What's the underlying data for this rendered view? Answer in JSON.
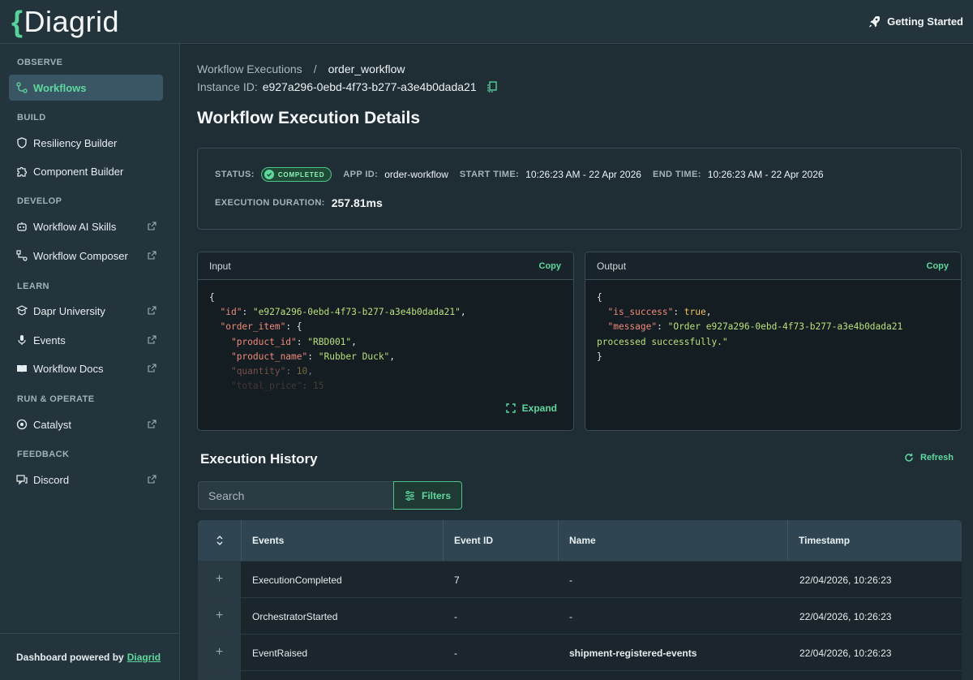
{
  "app": {
    "logo_brace": "{",
    "logo_text": "Diagrid"
  },
  "header": {
    "getting_started": "Getting Started"
  },
  "sidebar": {
    "sections": {
      "observe": "OBSERVE",
      "build": "BUILD",
      "develop": "DEVELOP",
      "learn": "LEARN",
      "run_operate": "RUN & OPERATE",
      "feedback": "FEEDBACK"
    },
    "items": {
      "workflows": "Workflows",
      "resiliency_builder": "Resiliency Builder",
      "component_builder": "Component Builder",
      "workflow_ai_skills": "Workflow AI Skills",
      "workflow_composer": "Workflow Composer",
      "dapr_university": "Dapr University",
      "events": "Events",
      "workflow_docs": "Workflow Docs",
      "catalyst": "Catalyst",
      "discord": "Discord"
    },
    "powered_by": "Dashboard powered by",
    "powered_link": "Diagrid"
  },
  "breadcrumb": {
    "parent": "Workflow Executions",
    "separator": "/",
    "current": "order_workflow"
  },
  "instance": {
    "label": "Instance ID:",
    "value": "e927a296-0ebd-4f73-b277-a3e4b0dada21"
  },
  "page_title": "Workflow Execution Details",
  "details": {
    "status_label": "STATUS:",
    "status_value": "COMPLETED",
    "app_id_label": "APP ID:",
    "app_id_value": "order-workflow",
    "start_label": "START TIME:",
    "start_value": "10:26:23 AM - 22 Apr 2026",
    "end_label": "END TIME:",
    "end_value": "10:26:23 AM - 22 Apr 2026",
    "duration_label": "EXECUTION DURATION:",
    "duration_value": "257.81ms"
  },
  "input_panel": {
    "title": "Input",
    "copy": "Copy",
    "expand": "Expand",
    "lines": {
      "open": "{",
      "id_key": "\"id\"",
      "id_val": "\"e927a296-0ebd-4f73-b277-a3e4b0dada21\"",
      "order_key": "\"order_item\"",
      "order_open": ": {",
      "pid_key": "\"product_id\"",
      "pid_val": "\"RBD001\"",
      "pname_key": "\"product_name\"",
      "pname_val": "\"Rubber Duck\"",
      "qty_key": "\"quantity\"",
      "qty_val": "10",
      "price_key": "\"total_price\"",
      "price_val": "15"
    }
  },
  "output_panel": {
    "title": "Output",
    "copy": "Copy",
    "lines": {
      "open": "{",
      "succ_key": "\"is_success\"",
      "succ_val": "true",
      "msg_key": "\"message\"",
      "msg_val1": "\"Order e927a296-0ebd-4f73-b277-a3e4b0dada21",
      "msg_val2": "processed successfully.\"",
      "close": "}"
    }
  },
  "history": {
    "title": "Execution History",
    "refresh": "Refresh",
    "search_placeholder": "Search",
    "filters": "Filters",
    "columns": {
      "events": "Events",
      "event_id": "Event ID",
      "name": "Name",
      "timestamp": "Timestamp"
    },
    "rows": [
      {
        "expander": "+",
        "event": "ExecutionCompleted",
        "event_id": "7",
        "name": "-",
        "timestamp": "22/04/2026, 10:26:23"
      },
      {
        "expander": "+",
        "event": "OrchestratorStarted",
        "event_id": "-",
        "name": "-",
        "timestamp": "22/04/2026, 10:26:23"
      },
      {
        "expander": "+",
        "event": "EventRaised",
        "event_id": "-",
        "name": "shipment-registered-events",
        "timestamp": "22/04/2026, 10:26:23"
      }
    ]
  },
  "colors": {
    "accent": "#5fd89e",
    "background": "#1f2d35",
    "sidebar": "#24343d"
  }
}
